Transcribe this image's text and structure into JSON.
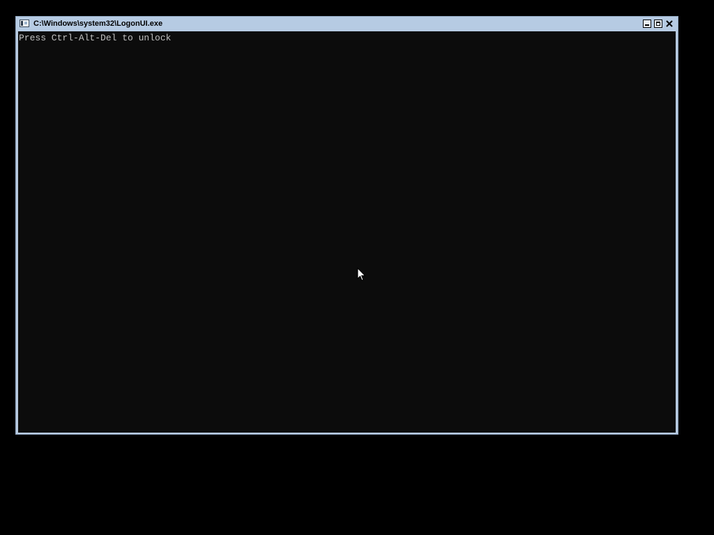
{
  "window": {
    "title": "C:\\Windows\\system32\\LogonUI.exe",
    "icon": "console-app-icon",
    "controls": {
      "minimize": "minimize-icon",
      "maximize": "maximize-icon",
      "close": "close-icon"
    }
  },
  "console": {
    "text": "Press Ctrl-Alt-Del to unlock",
    "text_color": "#c0c0c0",
    "background_color": "#0c0c0c"
  },
  "desktop": {
    "background_color": "#000000",
    "pointer": "mouse-pointer-icon"
  }
}
